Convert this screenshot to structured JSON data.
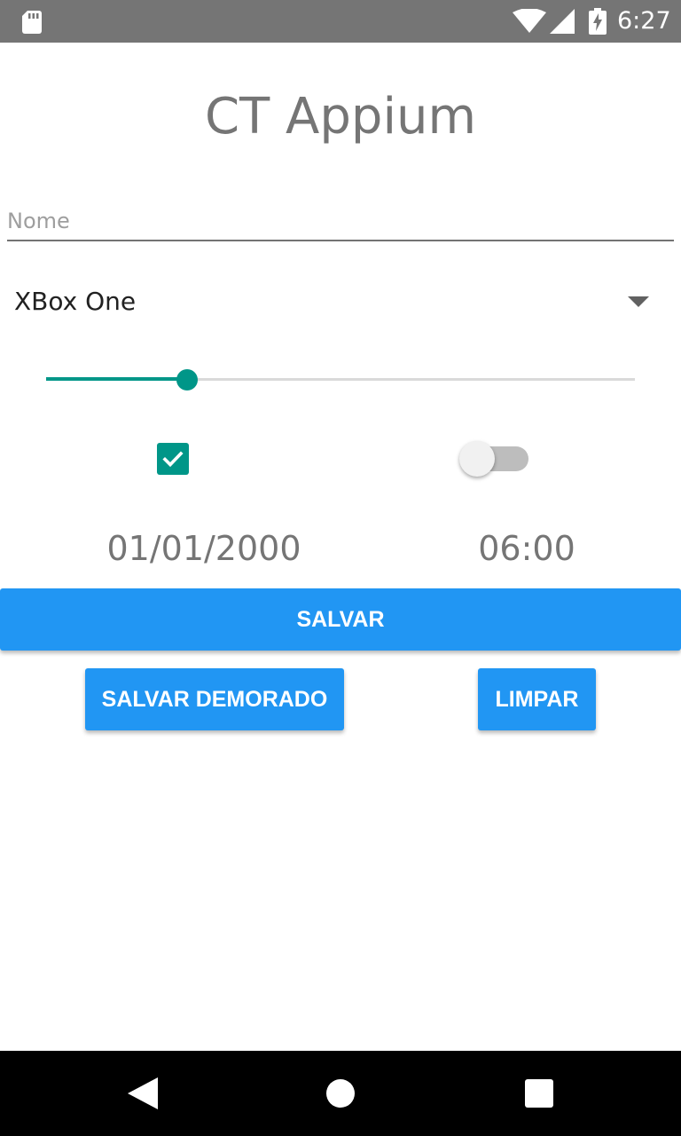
{
  "status_bar": {
    "time": "6:27",
    "icons": [
      "sd-card-icon",
      "wifi-icon",
      "cell-signal-icon",
      "battery-charging-icon"
    ],
    "background": "#757575"
  },
  "app": {
    "title": "CT Appium"
  },
  "form": {
    "name_input": {
      "value": "",
      "placeholder": "Nome"
    },
    "console_spinner": {
      "selected": "XBox One",
      "icon": "dropdown-arrow-icon"
    },
    "slider": {
      "value_fraction": 0.24,
      "accent": "#009688"
    },
    "checkbox": {
      "checked": true,
      "accent": "#009688"
    },
    "switch": {
      "on": false
    },
    "date": "01/01/2000",
    "time": "06:00"
  },
  "buttons": {
    "save_label": "SALVAR",
    "save_delayed_label": "SALVAR DEMORADO",
    "clear_label": "LIMPAR",
    "color": "#2196f3"
  },
  "nav_bar": {
    "icons": [
      "back-icon",
      "home-icon",
      "recents-icon"
    ],
    "background": "#000000"
  }
}
